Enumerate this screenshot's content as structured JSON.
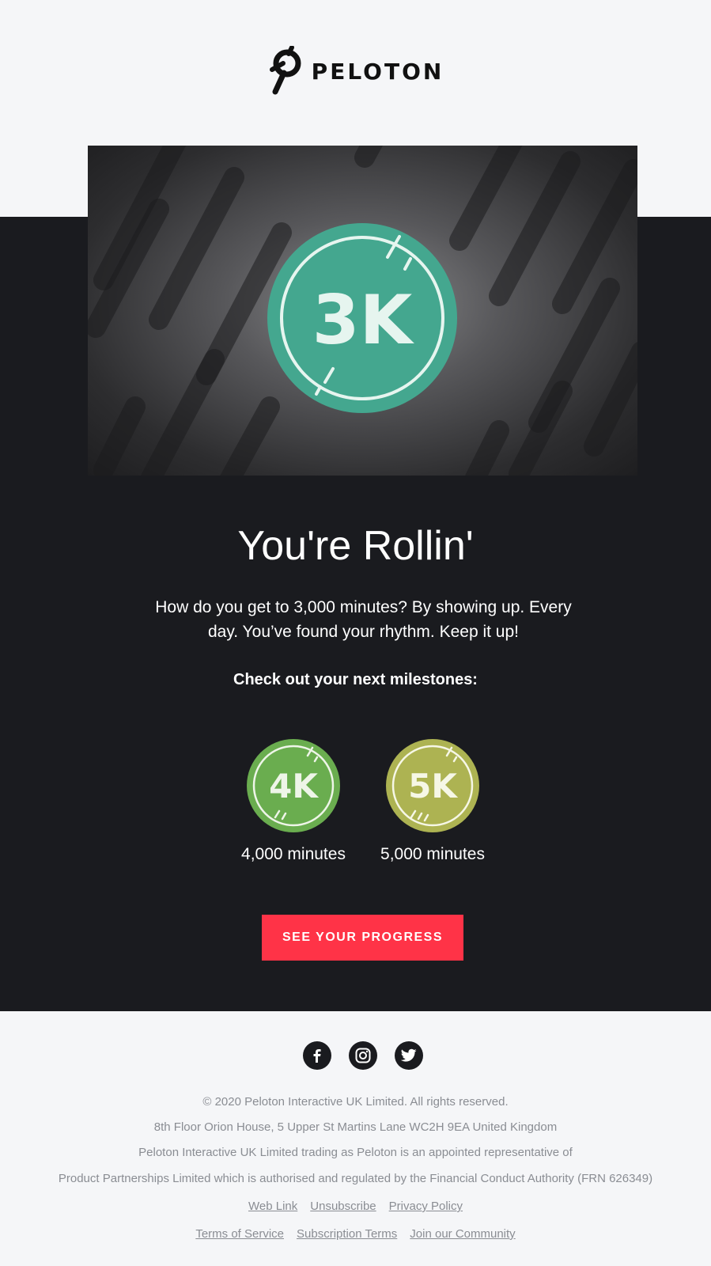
{
  "brand": {
    "name": "PELOTON"
  },
  "hero": {
    "badge_text": "3K",
    "badge_color": "#4aab94"
  },
  "content": {
    "title": "You're Rollin'",
    "body_line1": "How do you get to 3,000 minutes? By showing up. Every",
    "body_line2": "day. You’ve found your rhythm. Keep it up!",
    "milestones_heading": "Check out your next milestones:",
    "milestones": [
      {
        "badge_text": "4K",
        "label": "4,000 minutes",
        "color": "#6aad4f"
      },
      {
        "badge_text": "5K",
        "label": "5,000 minutes",
        "color": "#adb352"
      }
    ],
    "cta_label": "SEE YOUR PROGRESS"
  },
  "colors": {
    "accent": "#ff3347",
    "dark_bg": "#1a1b1f",
    "light_bg": "#f5f6f8"
  },
  "social": [
    "facebook-icon",
    "instagram-icon",
    "twitter-icon"
  ],
  "footer": {
    "copyright": "© 2020 Peloton Interactive UK Limited. All rights reserved.",
    "address": "8th Floor Orion House, 5 Upper St Martins Lane WC2H 9EA United Kingdom",
    "legal_line1": "Peloton Interactive UK Limited trading as Peloton is an appointed representative of",
    "legal_line2": "Product Partnerships Limited which is authorised and regulated by the Financial Conduct Authority (FRN 626349)",
    "links_row1": [
      "Web Link",
      "Unsubscribe",
      "Privacy Policy"
    ],
    "links_row2": [
      "Terms of Service",
      "Subscription Terms",
      "Join our Community"
    ]
  }
}
